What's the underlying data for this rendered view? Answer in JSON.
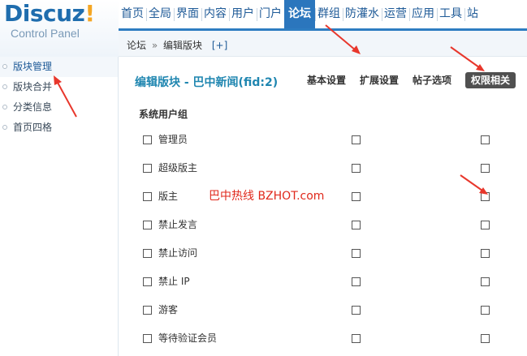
{
  "brand": {
    "logo_word": "Discuz",
    "logo_bang": "!",
    "logo_sub": "Control Panel"
  },
  "nav": {
    "items": [
      "首页",
      "全局",
      "界面",
      "内容",
      "用户",
      "门户",
      "论坛",
      "群组",
      "防灌水",
      "运营",
      "应用",
      "工具",
      "站"
    ],
    "active_index": 6
  },
  "sidebar": {
    "items": [
      {
        "label": "版块管理",
        "active": true
      },
      {
        "label": "版块合并",
        "active": false
      },
      {
        "label": "分类信息",
        "active": false
      },
      {
        "label": "首页四格",
        "active": false
      }
    ]
  },
  "breadcrumb": {
    "root": "论坛",
    "separator": "»",
    "current": "编辑版块",
    "action": "[+]"
  },
  "main": {
    "title": "编辑版块 - 巴中新闻(fid:2)",
    "tabs": [
      {
        "label": "基本设置",
        "active": false
      },
      {
        "label": "扩展设置",
        "active": false
      },
      {
        "label": "帖子选项",
        "active": false
      },
      {
        "label": "权限相关",
        "active": true
      }
    ],
    "group_heading": "系统用户组",
    "rows": [
      {
        "label": "管理员"
      },
      {
        "label": "超级版主"
      },
      {
        "label": "版主"
      },
      {
        "label": "禁止发言"
      },
      {
        "label": "禁止访问"
      },
      {
        "label": "禁止 IP"
      },
      {
        "label": "游客"
      },
      {
        "label": "等待验证会员"
      }
    ]
  },
  "watermark": "巴中热线 BZHOT.com",
  "colors": {
    "nav_active_bg": "#2b76bd",
    "title_color": "#1f86b0",
    "active_tab_bg": "#505050",
    "annotation_arrow": "#e8372c",
    "watermark": "#e0291c"
  }
}
